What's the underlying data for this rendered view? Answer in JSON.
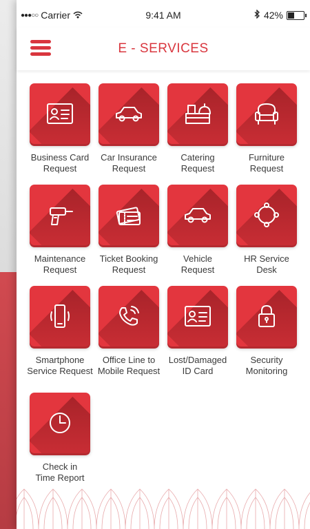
{
  "status_bar": {
    "signal": "●●●○○",
    "carrier": "Carrier",
    "time": "9:41 AM",
    "battery_text": "42%",
    "battery_level": 0.42
  },
  "header": {
    "title": "E - SERVICES",
    "menu_icon": "hamburger-icon"
  },
  "accent_color": "#d9363e",
  "tiles": [
    {
      "label": "Business Card\nRequest",
      "icon": "id-card-icon"
    },
    {
      "label": "Car Insurance\nRequest",
      "icon": "car-icon"
    },
    {
      "label": "Catering\nRequest",
      "icon": "catering-cart-icon"
    },
    {
      "label": "Furniture\nRequest",
      "icon": "armchair-icon"
    },
    {
      "label": "Maintenance\nRequest",
      "icon": "drill-icon"
    },
    {
      "label": "Ticket Booking\nRequest",
      "icon": "tickets-icon"
    },
    {
      "label": "Vehicle\nRequest",
      "icon": "car-icon"
    },
    {
      "label": "HR Service\nDesk",
      "icon": "people-circle-icon"
    },
    {
      "label": "Smartphone\nService Request",
      "icon": "smartphone-icon"
    },
    {
      "label": "Office Line to\nMobile Request",
      "icon": "phone-call-icon"
    },
    {
      "label": "Lost/Damaged\nID Card",
      "icon": "id-card-icon"
    },
    {
      "label": "Security\nMonitoring",
      "icon": "padlock-icon"
    },
    {
      "label": "Check in\nTime Report",
      "icon": "clock-icon"
    }
  ]
}
